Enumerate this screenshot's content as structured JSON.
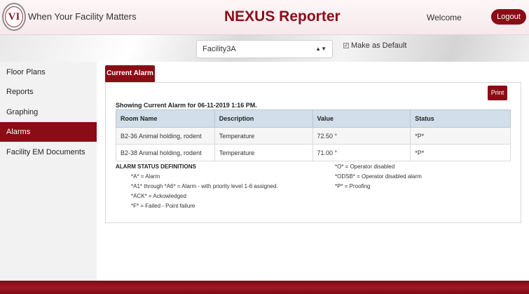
{
  "header": {
    "logo_text": "VI",
    "tagline": "When Your Facility Matters",
    "app_title": "NEXUS Reporter",
    "welcome": "Welcome",
    "logout_label": "Logout"
  },
  "toolbar": {
    "facility_selected": "Facility3A",
    "make_default_label": "Make as Default",
    "make_default_checked": true
  },
  "sidebar": {
    "items": [
      {
        "label": "Floor Plans",
        "active": false
      },
      {
        "label": "Reports",
        "active": false
      },
      {
        "label": "Graphing",
        "active": false
      },
      {
        "label": "Alarms",
        "active": true
      },
      {
        "label": "Facility EM Documents",
        "active": false
      }
    ]
  },
  "main": {
    "tab_label": "Current Alarm",
    "print_label": "Print",
    "showing_text": "Showing Current Alarm for 06-11-2019 1:16 PM.",
    "table": {
      "headers": [
        "Room Name",
        "Description",
        "Value",
        "Status"
      ],
      "rows": [
        [
          "B2-36 Animal holding, rodent",
          "Temperature",
          "72.50 °",
          "*P*"
        ],
        [
          "B2-38 Animal holding, rodent",
          "Temperature",
          "71.00 °",
          "*P*"
        ]
      ]
    },
    "definitions": {
      "title": "ALARM STATUS DEFINITIONS",
      "left": [
        "*A* = Alarm",
        "*A1* through *A6* = Alarm - with priority level 1-6 assigned.",
        "*ACK* = Ackowledged",
        "*F* = Failed - Point failure"
      ],
      "right": [
        "*O* = Operator disabled",
        "*ODSB* = Operator disabled alarm",
        "*P* = Proofing"
      ]
    }
  },
  "colors": {
    "brand": "#8a0d16",
    "table_header": "#d2dfea"
  }
}
